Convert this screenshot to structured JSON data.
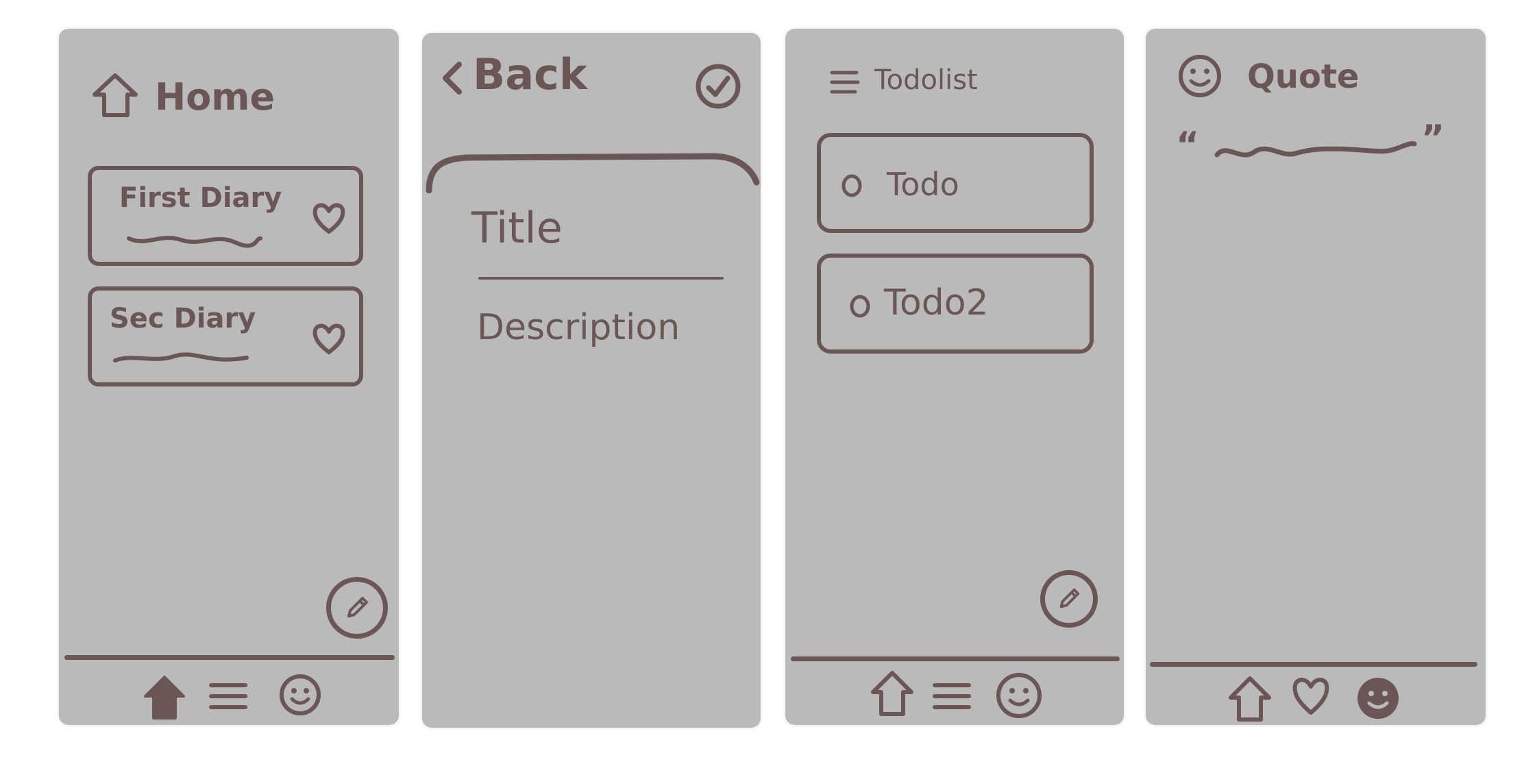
{
  "colors": {
    "screen": "#bababa",
    "ink": "#6b5656",
    "background": "#ffffff"
  },
  "screens": [
    {
      "name": "home",
      "header_title": "Home",
      "header_icon": "home-outline-icon",
      "cards": [
        {
          "label": "First Diary",
          "icon": "heart-icon"
        },
        {
          "label": "Sec Diary",
          "icon": "heart-icon"
        }
      ],
      "fab_icon": "pencil-icon",
      "nav": [
        "home-filled-icon",
        "menu-lines-icon",
        "smiley-icon"
      ]
    },
    {
      "name": "editor",
      "back_label": "Back",
      "back_icon": "chevron-left-icon",
      "confirm_icon": "check-circle-icon",
      "title_placeholder": "Title",
      "description_placeholder": "Description"
    },
    {
      "name": "todolist",
      "header_title": "Todolist",
      "header_icon": "menu-lines-icon",
      "items": [
        {
          "label": "Todo",
          "icon": "circle-checkbox-icon"
        },
        {
          "label": "Todo2",
          "icon": "circle-checkbox-icon"
        }
      ],
      "fab_icon": "pencil-icon",
      "nav": [
        "home-outline-icon",
        "menu-lines-icon",
        "smiley-icon"
      ]
    },
    {
      "name": "quote",
      "header_title": "Quote",
      "header_icon": "smiley-icon",
      "quote_open": "“",
      "quote_close": "”",
      "nav": [
        "home-outline-icon",
        "heart-icon",
        "smiley-filled-icon"
      ]
    }
  ]
}
